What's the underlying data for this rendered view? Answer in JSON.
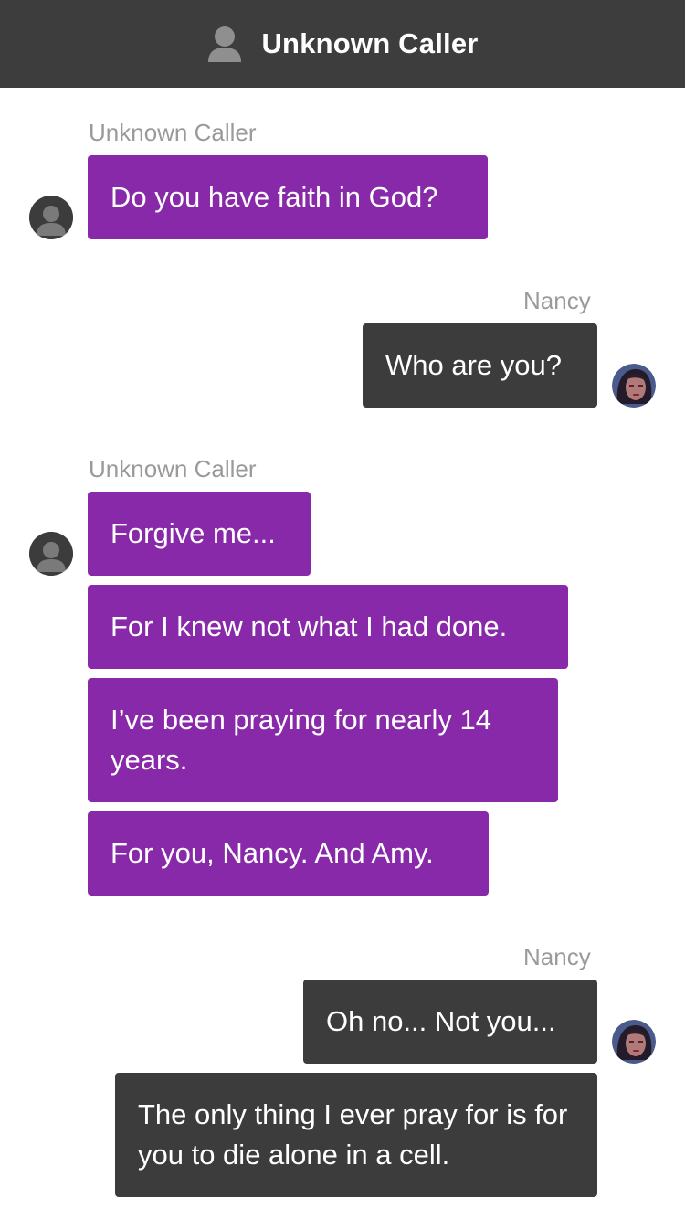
{
  "header": {
    "title": "Unknown Caller",
    "icon": "person-icon"
  },
  "groups": [
    {
      "sender": "Unknown Caller",
      "messages": [
        "Do you have faith in God?"
      ]
    },
    {
      "sender": "Nancy",
      "messages": [
        "Who are you?"
      ]
    },
    {
      "sender": "Unknown Caller",
      "messages": [
        "Forgive me...",
        "For I knew not what I had done.",
        "I’ve been praying for nearly 14 years.",
        "For you, Nancy. And Amy."
      ]
    },
    {
      "sender": "Nancy",
      "messages": [
        "Oh no... Not you...",
        "The only thing I ever pray for is for you to die alone in a cell."
      ]
    }
  ],
  "colors": {
    "header": "#3d3d3d",
    "incoming_bubble": "#8729a8",
    "outgoing_bubble": "#3c3c3c",
    "sender_label": "#9a9a9a"
  },
  "avatars": {
    "unknown": "person-icon",
    "nancy": "nancy-avatar"
  }
}
